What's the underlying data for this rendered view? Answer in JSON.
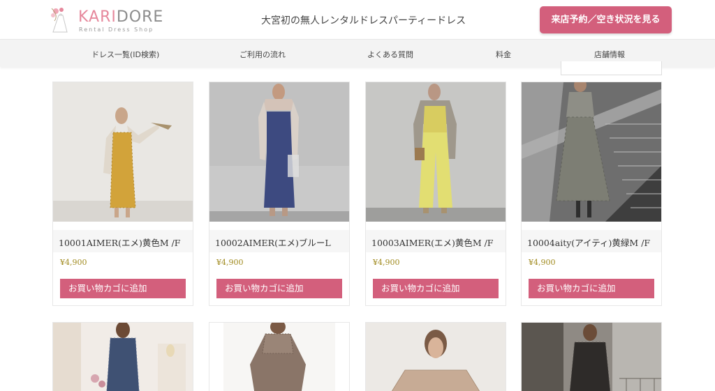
{
  "header": {
    "logo": {
      "brand_part1": "KARI",
      "brand_part2": "DORE",
      "sub": "Rental Dress Shop"
    },
    "tagline": "大宮初の無人レンタルドレスパーティードレス",
    "cta_label": "来店予約／空き状況を見る"
  },
  "nav": {
    "items": [
      {
        "label": "ドレス一覧(ID検索)"
      },
      {
        "label": "ご利用の流れ"
      },
      {
        "label": "よくある質問"
      },
      {
        "label": "料金"
      },
      {
        "label": "店舗情報"
      }
    ]
  },
  "products": [
    {
      "name": "10001AIMER(エメ)黄色M /F",
      "price": "¥4,900",
      "button": "お買い物カゴに追加"
    },
    {
      "name": "10002AIMER(エメ)ブルーL",
      "price": "¥4,900",
      "button": "お買い物カゴに追加"
    },
    {
      "name": "10003AIMER(エメ)黄色M /F",
      "price": "¥4,900",
      "button": "お買い物カゴに追加"
    },
    {
      "name": "10004aity(アイティ)黄緑M /F",
      "price": "¥4,900",
      "button": "お買い物カゴに追加"
    }
  ],
  "colors": {
    "accent": "#d35f7c",
    "logo_pink": "#e6889c",
    "price": "#a08a1e"
  }
}
